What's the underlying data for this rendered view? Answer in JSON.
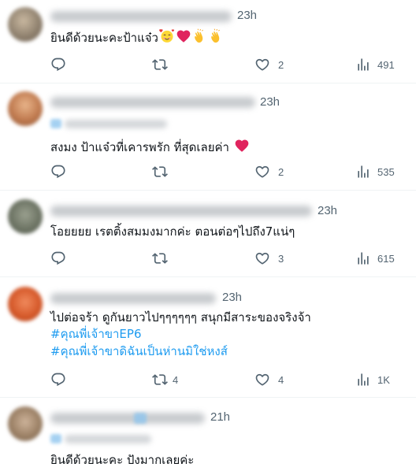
{
  "tweets": [
    {
      "time": "23h",
      "lines": [
        "ยินดีด้วยนะคะป้าแจ๋ว"
      ],
      "emojis": [
        "smiling-face-with-hearts-emoji",
        "red-heart-emoji",
        "clapping-hands-emoji",
        "clapping-hands-emoji"
      ],
      "hashtags": [],
      "stats": {
        "replies": "",
        "retweets": "",
        "likes": "2",
        "views": "491"
      }
    },
    {
      "time": "23h",
      "lines": [
        "สงมง ป้าแจ๋วที่เคารพรัก ที่สุดเลยค่า"
      ],
      "emojis": [
        "red-heart-emoji"
      ],
      "hashtags": [],
      "stats": {
        "replies": "",
        "retweets": "",
        "likes": "2",
        "views": "535"
      }
    },
    {
      "time": "23h",
      "lines": [
        "โอยยยย เรตติ้งสมมงมากค่ะ ตอนต่อๆไปถึง7แน่ๆ"
      ],
      "emojis": [],
      "hashtags": [],
      "stats": {
        "replies": "",
        "retweets": "",
        "likes": "3",
        "views": "615"
      }
    },
    {
      "time": "23h",
      "lines": [
        "ไปต่อจร้า ดูกันยาวไปๆๆๆๆๆๆ สนุกมีสาระของจริงจ้า"
      ],
      "emojis": [],
      "hashtags": [
        "#คุณพี่เจ้าขาEP6",
        "#คุณพี่เจ้าขาดิฉันเป็นห่านมิใช่หงส์"
      ],
      "stats": {
        "replies": "",
        "retweets": "4",
        "likes": "4",
        "views": "1K"
      }
    },
    {
      "time": "21h",
      "lines": [
        "ยินดีด้วยนะคะ ปังมากเลยค่ะ"
      ],
      "emojis": [],
      "hashtags": [],
      "stats": {}
    }
  ],
  "colors": {
    "text": "#0f1419",
    "muted": "#536471",
    "hashtag": "#1d9bf0",
    "heart": "#f91880",
    "divider": "#eff3f4"
  },
  "icons": {
    "reply": "reply-icon",
    "retweet": "retweet-icon",
    "like": "like-icon",
    "views": "views-icon"
  }
}
